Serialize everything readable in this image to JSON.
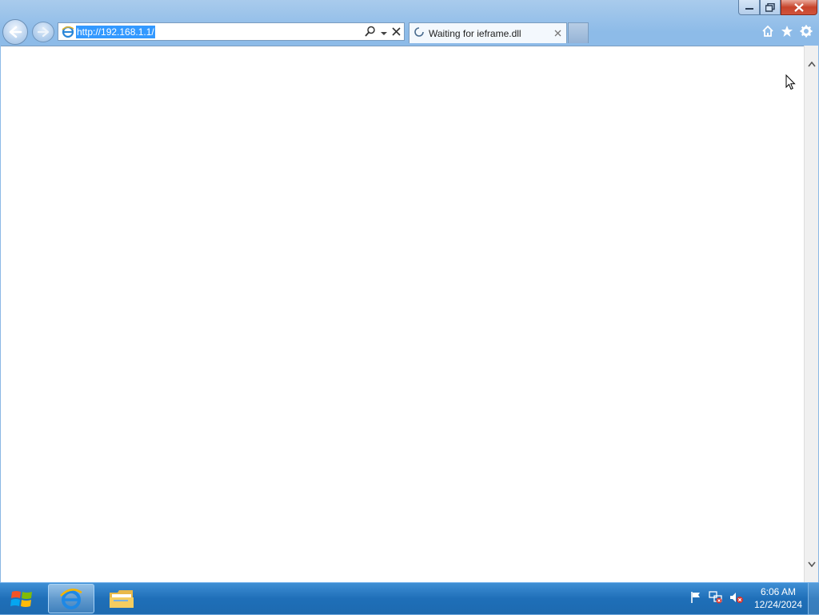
{
  "window": {
    "minimize_label": "minimize",
    "maximize_label": "restore",
    "close_label": "close"
  },
  "toolbar": {
    "back_icon": "back-arrow-icon",
    "forward_icon": "forward-arrow-icon",
    "address_url": "http://192.168.1.1/",
    "search_icon": "search-icon",
    "dropdown_icon": "chevron-down-icon",
    "stop_icon": "close-icon"
  },
  "tab": {
    "title": "Waiting for ieframe.dll",
    "close_icon": "close-icon"
  },
  "command_icons": [
    "home-icon",
    "star-icon",
    "gear-icon"
  ],
  "taskbar": {
    "time": "6:06 AM",
    "date": "12/24/2024",
    "tray_icons": [
      "flag-icon",
      "network-icon",
      "volume-muted-icon"
    ]
  },
  "colors": {
    "selection": "#3399ff",
    "taskbar": "#1f6fb8",
    "close_button": "#c7432b"
  }
}
